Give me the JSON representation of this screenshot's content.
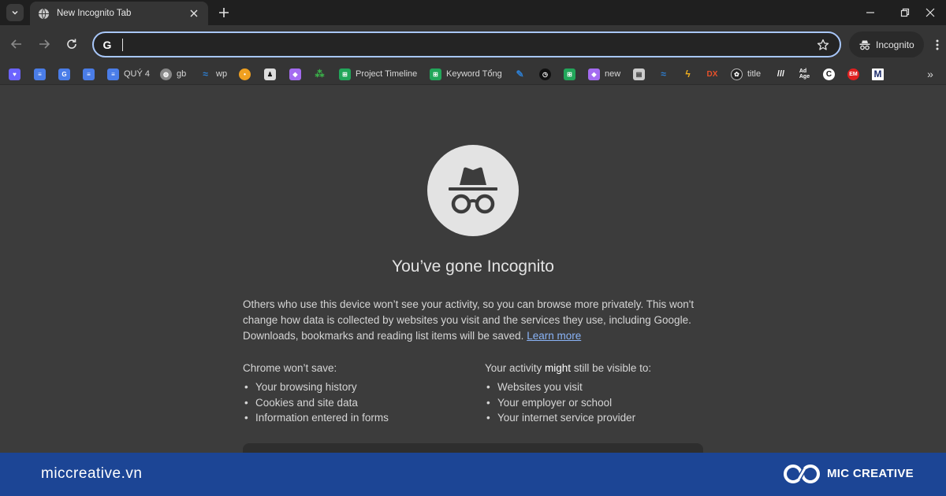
{
  "browser": {
    "tab_title": "New Incognito Tab",
    "profile_label": "Incognito",
    "omnibox": {
      "value": "",
      "search_engine_icon": "G"
    }
  },
  "bookmarks": [
    {
      "icon": "heart-icon",
      "label": "",
      "color": "#6b63ff"
    },
    {
      "icon": "docs-icon",
      "label": "",
      "color": "#4a7de8"
    },
    {
      "icon": "translate-icon",
      "label": "",
      "color": "#4a7de8"
    },
    {
      "icon": "docs-icon",
      "label": "",
      "color": "#4a7de8"
    },
    {
      "icon": "docs-icon",
      "label": "QUÝ 4",
      "color": "#4a7de8"
    },
    {
      "icon": "globe-icon",
      "label": "gb",
      "color": "#888888"
    },
    {
      "icon": "wave-icon",
      "label": "wp",
      "color": "#2d7fd3"
    },
    {
      "icon": "circle-icon",
      "label": "",
      "color": "#f0a020"
    },
    {
      "icon": "person-icon",
      "label": "",
      "color": "#dddddd"
    },
    {
      "icon": "puzzle-icon",
      "label": "",
      "color": "#a46bf0"
    },
    {
      "icon": "nodes-icon",
      "label": "",
      "color": "#3bb54a"
    },
    {
      "icon": "sheets-icon",
      "label": "Project Timeline",
      "color": "#22a65a"
    },
    {
      "icon": "sheets-icon",
      "label": "Keyword Tổng",
      "color": "#22a65a"
    },
    {
      "icon": "edit-icon",
      "label": "",
      "color": "#2d7fd3"
    },
    {
      "icon": "timer-icon",
      "label": "",
      "color": "#111111"
    },
    {
      "icon": "sheets-icon",
      "label": "",
      "color": "#22a65a"
    },
    {
      "icon": "puzzle-icon",
      "label": "new",
      "color": "#a46bf0"
    },
    {
      "icon": "store-icon",
      "label": "",
      "color": "#cccccc"
    },
    {
      "icon": "wave-icon",
      "label": "",
      "color": "#2d7fd3"
    },
    {
      "icon": "bolt-icon",
      "label": "",
      "color": "#f2b01e"
    },
    {
      "icon": "dx-icon",
      "label": "",
      "color": "#e8502a"
    },
    {
      "icon": "openai-icon",
      "label": "title",
      "color": "#222222"
    },
    {
      "icon": "stripes-icon",
      "label": "",
      "color": "#ffffff"
    },
    {
      "icon": "adage-icon",
      "label": "",
      "color": "#ffffff"
    },
    {
      "icon": "c-icon",
      "label": "",
      "color": "#ffffff"
    },
    {
      "icon": "em-icon",
      "label": "",
      "color": "#e02020"
    },
    {
      "icon": "m-icon",
      "label": "",
      "color": "#ffffff"
    }
  ],
  "page": {
    "title": "You’ve gone Incognito",
    "intro": "Others who use this device won’t see your activity, so you can browse more privately. This won't change how data is collected by websites you visit and the services they use, including Google. Downloads, bookmarks and reading list items will be saved.",
    "learn_more": "Learn more",
    "wont_save": {
      "heading": "Chrome won’t save:",
      "items": [
        "Your browsing history",
        "Cookies and site data",
        "Information entered in forms"
      ]
    },
    "might_visible": {
      "heading_prefix": "Your activity ",
      "heading_bold": "might",
      "heading_suffix": " still be visible to:",
      "items": [
        "Websites you visit",
        "Your employer or school",
        "Your internet service provider"
      ]
    }
  },
  "footer": {
    "site": "miccreative.vn",
    "brand": "MIC CREATIVE"
  },
  "colors": {
    "accent": "#a8c7fa",
    "link": "#8ab4f8",
    "footer_bg": "#1c4595"
  }
}
